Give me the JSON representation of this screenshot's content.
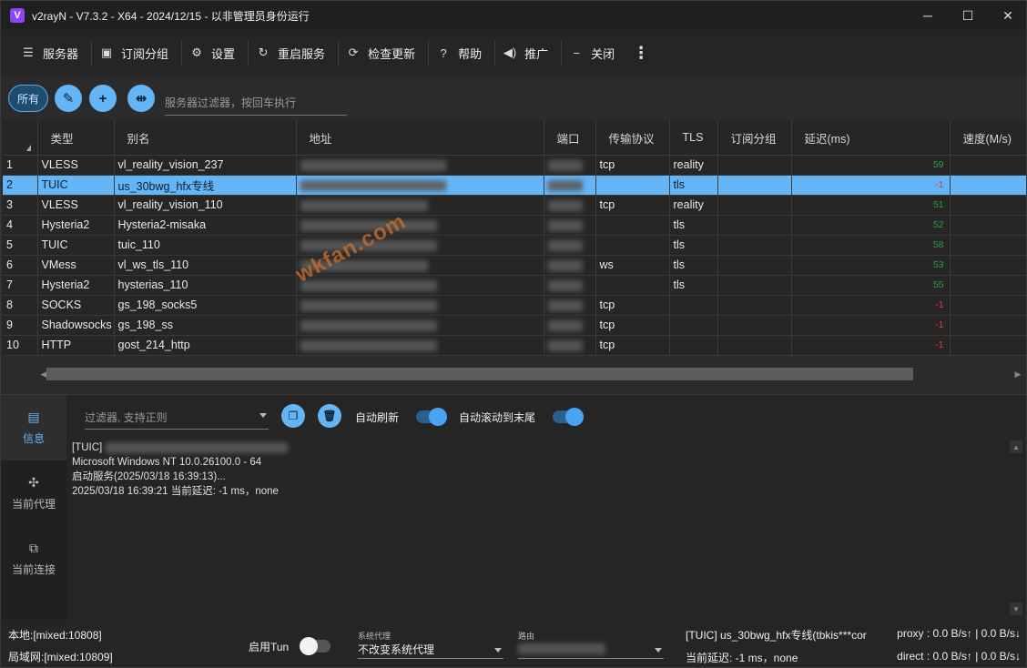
{
  "window": {
    "title": "v2rayN - V7.3.2 - X64 - 2024/12/15 - 以非管理员身份运行",
    "logo": "V",
    "controls": {
      "minimize": "─",
      "maximize": "☐",
      "close": "✕"
    }
  },
  "toolbar": {
    "items": [
      {
        "label": "服务器",
        "icon": "server-icon",
        "glyph": "☰"
      },
      {
        "label": "订阅分组",
        "icon": "subscription-icon",
        "glyph": "▣"
      },
      {
        "label": "设置",
        "icon": "gear-icon",
        "glyph": "⚙"
      },
      {
        "label": "重启服务",
        "icon": "restart-icon",
        "glyph": "↻"
      },
      {
        "label": "检查更新",
        "icon": "update-icon",
        "glyph": "⟳"
      },
      {
        "label": "帮助",
        "icon": "help-icon",
        "glyph": "?"
      },
      {
        "label": "推广",
        "icon": "promote-icon",
        "glyph": "◀)"
      },
      {
        "label": "关闭",
        "icon": "close-minus-icon",
        "glyph": "−"
      }
    ],
    "more": "⋮"
  },
  "filter": {
    "all_label": "所有",
    "placeholder": "服务器过滤器，按回车执行",
    "edit_glyph": "✎",
    "add_glyph": "+",
    "speed_glyph": "⇹"
  },
  "table": {
    "headers": [
      "类型",
      "别名",
      "地址",
      "端口",
      "传输协议",
      "TLS",
      "订阅分组",
      "延迟(ms)",
      "速度(M/s)"
    ],
    "rows": [
      {
        "n": "1",
        "type": "VLESS",
        "alias": "vl_reality_vision_237",
        "transport": "tcp",
        "tls": "reality",
        "delay": "59"
      },
      {
        "n": "2",
        "type": "TUIC",
        "alias": "us_30bwg_hfx专线",
        "transport": "",
        "tls": "tls",
        "delay": "-1"
      },
      {
        "n": "3",
        "type": "VLESS",
        "alias": "vl_reality_vision_110",
        "transport": "tcp",
        "tls": "reality",
        "delay": "51"
      },
      {
        "n": "4",
        "type": "Hysteria2",
        "alias": "Hysteria2-misaka",
        "transport": "",
        "tls": "tls",
        "delay": "52"
      },
      {
        "n": "5",
        "type": "TUIC",
        "alias": "tuic_110",
        "transport": "",
        "tls": "tls",
        "delay": "58"
      },
      {
        "n": "6",
        "type": "VMess",
        "alias": "vl_ws_tls_110",
        "transport": "ws",
        "tls": "tls",
        "delay": "53"
      },
      {
        "n": "7",
        "type": "Hysteria2",
        "alias": "hysterias_110",
        "transport": "",
        "tls": "tls",
        "delay": "55"
      },
      {
        "n": "8",
        "type": "SOCKS",
        "alias": "gs_198_socks5",
        "transport": "tcp",
        "tls": "",
        "delay": "-1"
      },
      {
        "n": "9",
        "type": "Shadowsocks",
        "alias": "gs_198_ss",
        "transport": "tcp",
        "tls": "",
        "delay": "-1"
      },
      {
        "n": "10",
        "type": "HTTP",
        "alias": "gost_214_http",
        "transport": "tcp",
        "tls": "",
        "delay": "-1"
      }
    ],
    "selected_index": 1,
    "colors": {
      "delay_ok": "#2e9e3e",
      "delay_fail": "#e53935",
      "selection": "#64b5f6"
    }
  },
  "watermark": "wkfan.com",
  "sidenav": [
    {
      "label": "信息",
      "icon": "info-icon",
      "glyph": "▤"
    },
    {
      "label": "当前代理",
      "icon": "proxy-icon",
      "glyph": "✣"
    },
    {
      "label": "当前连接",
      "icon": "connection-icon",
      "glyph": "⧉"
    }
  ],
  "log_panel": {
    "filter_placeholder": "过滤器, 支持正则",
    "copy_glyph": "❐",
    "delete_glyph": "🗑",
    "auto_refresh_label": "自动刷新",
    "auto_scroll_label": "自动滚动到末尾",
    "lines": [
      "[TUIC]",
      "Microsoft Windows NT 10.0.26100.0 - 64",
      "启动服务(2025/03/18 16:39:13)...",
      "2025/03/18 16:39:21 当前延迟: -1 ms，none"
    ]
  },
  "statusbar": {
    "local": "本地:[mixed:10808]",
    "lan": "局域网:[mixed:10809]",
    "tun_label": "启用Tun",
    "sysproxy_caption": "系统代理",
    "sysproxy_value": "不改变系统代理",
    "routing_caption": "路由",
    "current_server": "[TUIC] us_30bwg_hfx专线(tbkis***cor",
    "current_delay": "当前延迟: -1 ms，none",
    "proxy_speed": "proxy : 0.0 B/s↑ | 0.0 B/s↓",
    "direct_speed": "direct : 0.0 B/s↑ | 0.0 B/s↓"
  }
}
